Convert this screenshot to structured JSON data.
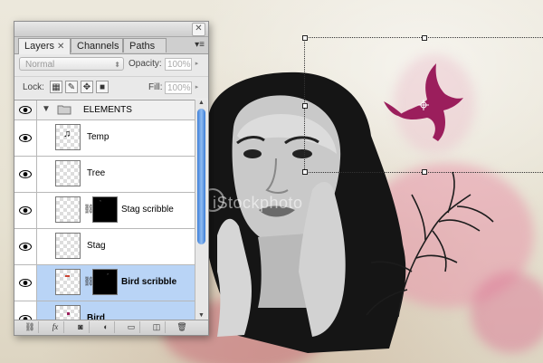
{
  "panel": {
    "tabs": [
      {
        "label": "Layers",
        "close": "✕"
      },
      {
        "label": "Channels"
      },
      {
        "label": "Paths"
      }
    ],
    "close_button": "✕",
    "menu_icon": "▾≡",
    "blend_mode": "Normal",
    "opacity_label": "Opacity:",
    "opacity_value": "100%",
    "lock_label": "Lock:",
    "fill_label": "Fill:",
    "fill_value": "100%",
    "lock_icons": [
      "lock-transparent-icon",
      "lock-image-icon",
      "lock-position-icon",
      "lock-all-icon"
    ],
    "group": {
      "name": "ELEMENTS",
      "icon": "folder-icon"
    },
    "layers": [
      {
        "name": "Temp",
        "has_mask": false,
        "selected": false,
        "bold": false
      },
      {
        "name": "Tree",
        "has_mask": false,
        "selected": false,
        "bold": false
      },
      {
        "name": "Stag scribble",
        "has_mask": true,
        "selected": false,
        "bold": false
      },
      {
        "name": "Stag",
        "has_mask": false,
        "selected": false,
        "bold": false
      },
      {
        "name": "Bird scribble",
        "has_mask": true,
        "selected": true,
        "bold": true
      },
      {
        "name": "Bird",
        "has_mask": false,
        "selected": true,
        "bold": true
      }
    ],
    "bottom_buttons": [
      "link-icon",
      "fx-icon",
      "mask-icon",
      "adjustment-icon",
      "folder-icon",
      "new-layer-icon",
      "trash-icon"
    ]
  },
  "canvas": {
    "watermark": "iStockphoto",
    "accent": "#9b1e5c"
  }
}
